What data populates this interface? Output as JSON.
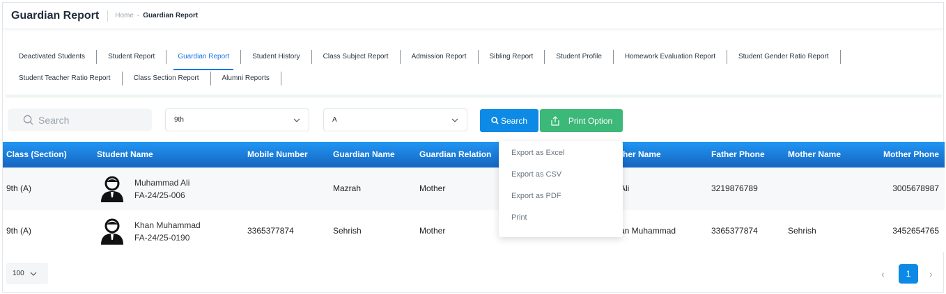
{
  "header": {
    "title": "Guardian Report",
    "breadcrumb_home": "Home",
    "breadcrumb_sep": "-",
    "breadcrumb_current": "Guardian Report"
  },
  "tabs": {
    "row1": [
      {
        "label": "Deactivated Students"
      },
      {
        "label": "Student Report"
      },
      {
        "label": "Guardian Report",
        "active": true
      },
      {
        "label": "Student History"
      },
      {
        "label": "Class Subject Report"
      },
      {
        "label": "Admission Report"
      },
      {
        "label": "Sibling Report"
      },
      {
        "label": "Student Profile"
      },
      {
        "label": "Homework Evaluation Report"
      },
      {
        "label": "Student Gender Ratio Report"
      }
    ],
    "row2": [
      {
        "label": "Student Teacher Ratio Report"
      },
      {
        "label": "Class Section Report"
      },
      {
        "label": "Alumni Reports"
      }
    ]
  },
  "filters": {
    "search_placeholder": "Search",
    "class_value": "9th",
    "section_value": "A",
    "search_button": "Search",
    "print_button": "Print Option"
  },
  "print_menu": [
    "Export as Excel",
    "Export as CSV",
    "Export as PDF",
    "Print"
  ],
  "table": {
    "columns": [
      "Class (Section)",
      "Student Name",
      "Mobile Number",
      "Guardian Name",
      "Guardian Relation",
      "ther Name",
      "Father Phone",
      "Mother Name",
      "Mother Phone"
    ],
    "rows": [
      {
        "class_section": "9th (A)",
        "student_name": "Muhammad Ali",
        "student_id": "FA-24/25-006",
        "mobile": "",
        "guardian_name": "Mazrah",
        "guardian_relation": "Mother",
        "father_name": "Ali",
        "father_phone": "3219876789",
        "mother_name": "",
        "mother_phone": "3005678987"
      },
      {
        "class_section": "9th (A)",
        "student_name": "Khan Muhammad",
        "student_id": "FA-24/25-0190",
        "mobile": "3365377874",
        "guardian_name": "Sehrish",
        "guardian_relation": "Mother",
        "father_name": "an Muhammad",
        "father_phone": "3365377874",
        "mother_name": "Sehrish",
        "mother_phone": "3452654765"
      }
    ]
  },
  "footer": {
    "page_size": "100",
    "current_page": "1",
    "prev": "‹",
    "next": "›"
  },
  "colors": {
    "primary": "#0d8ae6",
    "success": "#3cb878",
    "header_gradient_top": "#2196f3",
    "header_gradient_bottom": "#1565c0"
  }
}
